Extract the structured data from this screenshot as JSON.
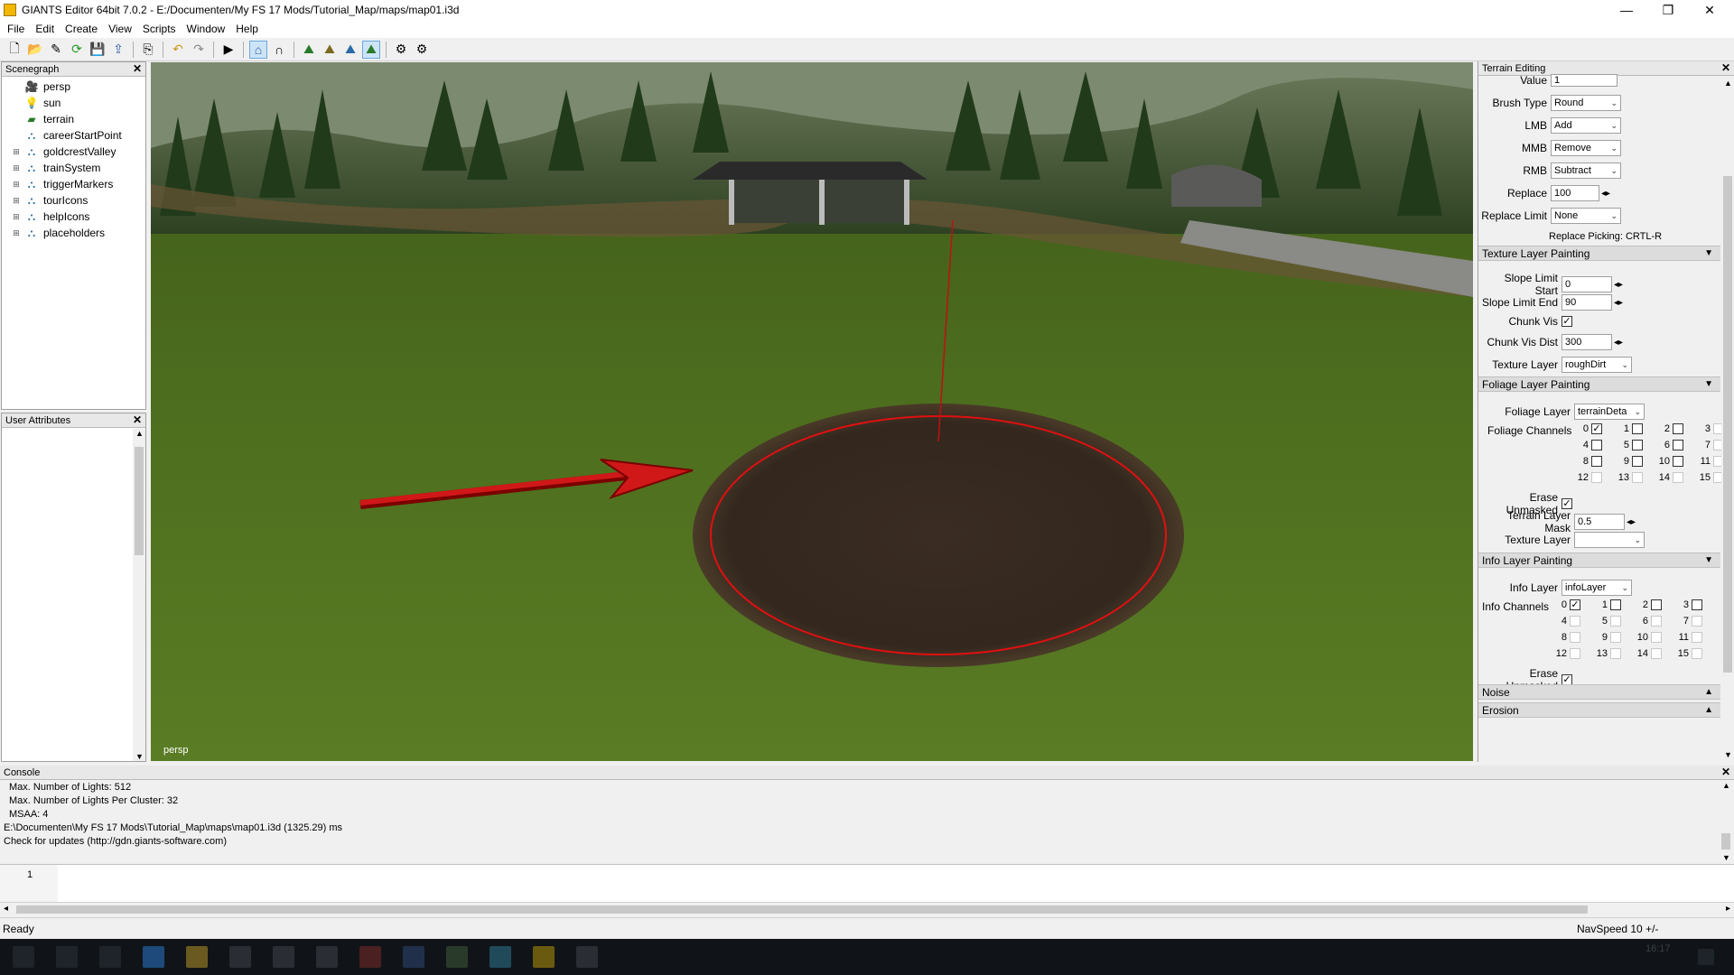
{
  "window": {
    "title": "GIANTS Editor 64bit 7.0.2 - E:/Documenten/My FS 17 Mods/Tutorial_Map/maps/map01.i3d"
  },
  "menu": [
    "File",
    "Edit",
    "Create",
    "View",
    "Scripts",
    "Window",
    "Help"
  ],
  "scenegraph": {
    "title": "Scenegraph",
    "items": [
      {
        "label": "persp",
        "icon": "camera-icon",
        "expandable": false
      },
      {
        "label": "sun",
        "icon": "light-bulb-icon",
        "expandable": false
      },
      {
        "label": "terrain",
        "icon": "terrain-icon",
        "expandable": false
      },
      {
        "label": "careerStartPoint",
        "icon": "transform-group-icon",
        "expandable": false
      },
      {
        "label": "goldcrestValley",
        "icon": "transform-group-icon",
        "expandable": true
      },
      {
        "label": "trainSystem",
        "icon": "transform-group-icon",
        "expandable": true
      },
      {
        "label": "triggerMarkers",
        "icon": "transform-group-icon",
        "expandable": true
      },
      {
        "label": "tourIcons",
        "icon": "transform-group-icon",
        "expandable": true
      },
      {
        "label": "helpIcons",
        "icon": "transform-group-icon",
        "expandable": true
      },
      {
        "label": "placeholders",
        "icon": "transform-group-icon",
        "expandable": true
      }
    ]
  },
  "user_attributes": {
    "title": "User Attributes"
  },
  "viewport": {
    "camera_label": "persp"
  },
  "terrain_editing": {
    "title": "Terrain Editing",
    "value_label": "Value",
    "value": "1",
    "brush_type_label": "Brush Type",
    "brush_type": "Round",
    "lmb_label": "LMB",
    "lmb": "Add",
    "mmb_label": "MMB",
    "mmb": "Remove",
    "rmb_label": "RMB",
    "rmb": "Subtract",
    "replace_label": "Replace",
    "replace": "100",
    "replace_limit_label": "Replace Limit",
    "replace_limit": "None",
    "replace_picking": "Replace Picking: CRTL-R"
  },
  "texture_layer_painting": {
    "title": "Texture Layer Painting",
    "slope_start_label": "Slope Limit Start",
    "slope_start": "0",
    "slope_end_label": "Slope Limit End",
    "slope_end": "90",
    "chunk_vis_label": "Chunk Vis",
    "chunk_vis": true,
    "chunk_vis_dist_label": "Chunk Vis Dist",
    "chunk_vis_dist": "300",
    "texture_layer_label": "Texture Layer",
    "texture_layer": "roughDirt"
  },
  "foliage_layer_painting": {
    "title": "Foliage Layer Painting",
    "foliage_layer_label": "Foliage Layer",
    "foliage_layer": "terrainDeta",
    "channels_label": "Foliage Channels",
    "channels": [
      "0",
      "1",
      "2",
      "3",
      "4",
      "5",
      "6",
      "7",
      "8",
      "9",
      "10",
      "11",
      "12",
      "13",
      "14",
      "15"
    ],
    "checked": [
      0
    ],
    "active": [
      0,
      1,
      2,
      4,
      5,
      6,
      8,
      9,
      10
    ],
    "erase_unmasked_label": "Erase Unmasked",
    "erase_unmasked": true,
    "terrain_layer_mask_label": "Terrain Layer Mask",
    "terrain_layer_mask": "0.5",
    "texture_layer_label": "Texture Layer",
    "texture_layer": ""
  },
  "info_layer_painting": {
    "title": "Info Layer Painting",
    "info_layer_label": "Info Layer",
    "info_layer": "infoLayer",
    "channels_label": "Info Channels",
    "channels": [
      "0",
      "1",
      "2",
      "3",
      "4",
      "5",
      "6",
      "7",
      "8",
      "9",
      "10",
      "11",
      "12",
      "13",
      "14",
      "15"
    ],
    "checked": [
      0
    ],
    "active": [
      0,
      1,
      2,
      3
    ],
    "erase_unmasked_label": "Erase Unmasked",
    "erase_unmasked": true
  },
  "noise": {
    "title": "Noise"
  },
  "erosion": {
    "title": "Erosion"
  },
  "console": {
    "title": "Console",
    "lines": [
      "Max. Number of Lights: 512",
      "Max. Number of Lights Per Cluster: 32",
      "MSAA: 4",
      "E:\\Documenten\\My FS 17 Mods\\Tutorial_Map\\maps\\map01.i3d (1325.29) ms",
      "Check for updates (http://gdn.giants-software.com)"
    ],
    "script_line_number": "1"
  },
  "status": {
    "left": "Ready",
    "right": "NavSpeed 10 +/-"
  },
  "taskbar": {
    "clock": "16:17"
  },
  "colors": {
    "grass": "#4a6a1e",
    "dirt": "#3a2c22",
    "brush_ring": "#e01010",
    "arrow": "#d01818"
  }
}
